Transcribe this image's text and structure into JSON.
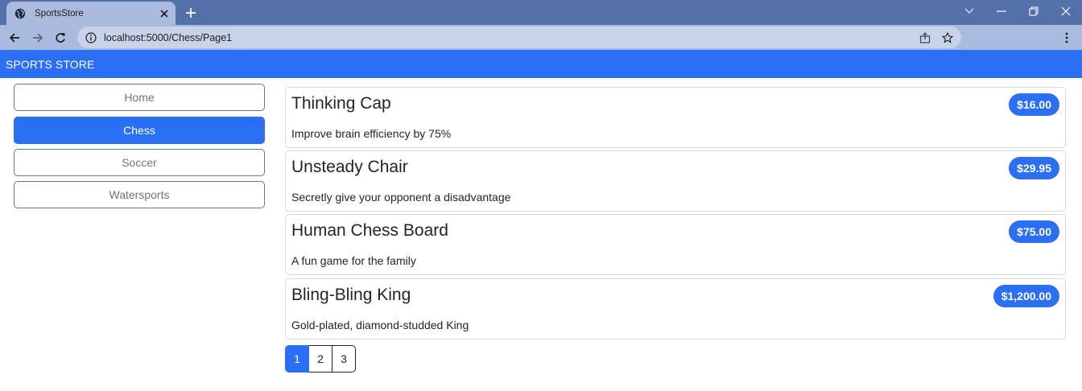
{
  "browser": {
    "tab_title": "SportsStore",
    "url": "localhost:5000/Chess/Page1"
  },
  "header": {
    "brand": "SPORTS STORE"
  },
  "categories": [
    {
      "label": "Home",
      "active": false
    },
    {
      "label": "Chess",
      "active": true
    },
    {
      "label": "Soccer",
      "active": false
    },
    {
      "label": "Watersports",
      "active": false
    }
  ],
  "products": [
    {
      "name": "Thinking Cap",
      "price": "$16.00",
      "description": "Improve brain efficiency by 75%"
    },
    {
      "name": "Unsteady Chair",
      "price": "$29.95",
      "description": "Secretly give your opponent a disadvantage"
    },
    {
      "name": "Human Chess Board",
      "price": "$75.00",
      "description": "A fun game for the family"
    },
    {
      "name": "Bling-Bling King",
      "price": "$1,200.00",
      "description": "Gold-plated, diamond-studded King"
    }
  ],
  "pagination": {
    "pages": [
      "1",
      "2",
      "3"
    ],
    "current": "1"
  },
  "colors": {
    "accent": "#2b6ff4",
    "tabstrip": "#5470a8",
    "toolbar": "#a9bbde"
  }
}
